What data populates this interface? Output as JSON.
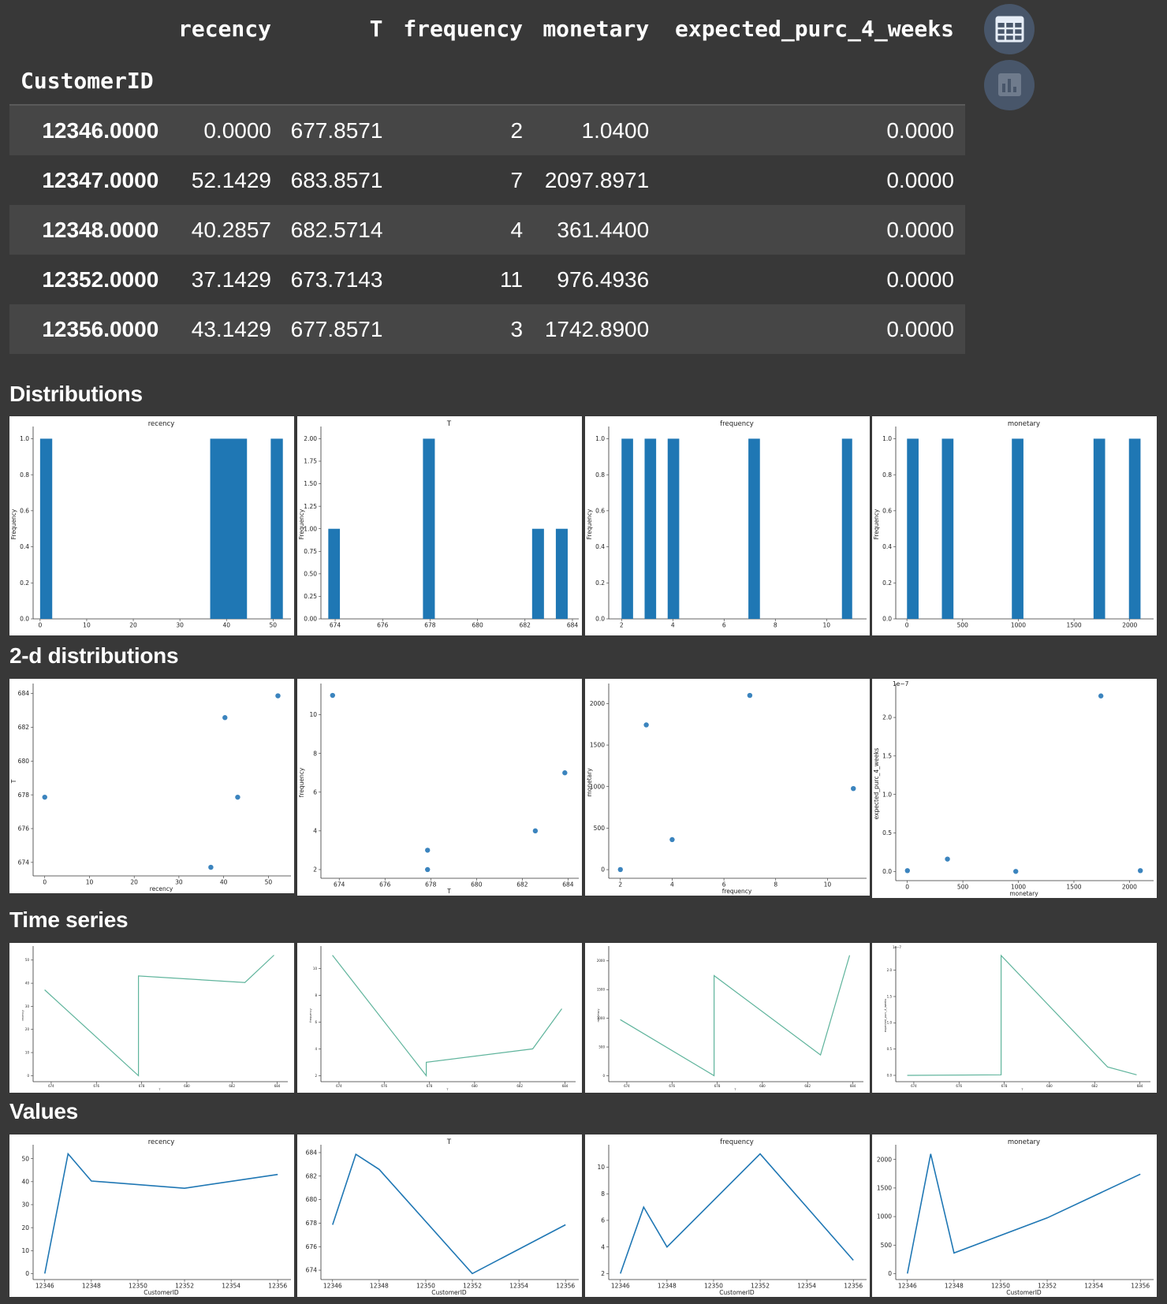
{
  "table": {
    "columns": [
      "recency",
      "T",
      "frequency",
      "monetary",
      "expected_purc_4_weeks"
    ],
    "index_name": "CustomerID",
    "rows": [
      {
        "id": "12346.0000",
        "cells": [
          "0.0000",
          "677.8571",
          "2",
          "1.0400",
          "0.0000"
        ]
      },
      {
        "id": "12347.0000",
        "cells": [
          "52.1429",
          "683.8571",
          "7",
          "2097.8971",
          "0.0000"
        ]
      },
      {
        "id": "12348.0000",
        "cells": [
          "40.2857",
          "682.5714",
          "4",
          "361.4400",
          "0.0000"
        ]
      },
      {
        "id": "12352.0000",
        "cells": [
          "37.1429",
          "673.7143",
          "11",
          "976.4936",
          "0.0000"
        ]
      },
      {
        "id": "12356.0000",
        "cells": [
          "43.1429",
          "677.8571",
          "3",
          "1742.8900",
          "0.0000"
        ]
      }
    ]
  },
  "side_buttons": {
    "table_icon": "table-icon",
    "chart_icon": "bar-chart-icon"
  },
  "sections": {
    "distributions": "Distributions",
    "bivariate": "2-d distributions",
    "timeseries": "Time series",
    "values": "Values"
  },
  "colors": {
    "bar": "#1f77b4",
    "line": "#1f77b4",
    "ts_line": "#5fb49c",
    "background": "#383838"
  },
  "chart_data": [
    {
      "type": "bar",
      "title": "recency",
      "ylabel": "Frequency",
      "xlabel": "",
      "bars": [
        [
          0,
          2.6,
          1
        ],
        [
          36.5,
          44.4,
          1
        ],
        [
          49.5,
          52.1,
          1
        ]
      ],
      "xlim": [
        -1.5,
        53.5
      ],
      "ylim": [
        0,
        1.05
      ],
      "xticks": [
        0,
        10,
        20,
        30,
        40,
        50
      ],
      "xtick_labels": [
        "0",
        "10",
        "20",
        "30",
        "40",
        "50"
      ],
      "yticks": [
        0,
        0.2,
        0.4,
        0.6,
        0.8,
        1.0
      ],
      "ytick_labels": [
        "0.0",
        "0.2",
        "0.4",
        "0.6",
        "0.8",
        "1.0"
      ]
    },
    {
      "type": "bar",
      "title": "T",
      "ylabel": "Frequency",
      "xlabel": "",
      "bars": [
        [
          673.71,
          674.2,
          1
        ],
        [
          677.7,
          678.2,
          2
        ],
        [
          682.3,
          682.8,
          1
        ],
        [
          683.3,
          683.8,
          1
        ]
      ],
      "xlim": [
        673.4,
        684.2
      ],
      "ylim": [
        0,
        2.1
      ],
      "xticks": [
        674,
        676,
        678,
        680,
        682,
        684
      ],
      "xtick_labels": [
        "674",
        "676",
        "678",
        "680",
        "682",
        "684"
      ],
      "yticks": [
        0,
        0.25,
        0.5,
        0.75,
        1.0,
        1.25,
        1.5,
        1.75,
        2.0
      ],
      "ytick_labels": [
        "0.00",
        "0.25",
        "0.50",
        "0.75",
        "1.00",
        "1.25",
        "1.50",
        "1.75",
        "2.00"
      ]
    },
    {
      "type": "bar",
      "title": "frequency",
      "ylabel": "Frequency",
      "xlabel": "",
      "bars": [
        [
          2,
          2.45,
          1
        ],
        [
          2.9,
          3.35,
          1
        ],
        [
          3.8,
          4.25,
          1
        ],
        [
          6.95,
          7.4,
          1
        ],
        [
          10.6,
          11,
          1
        ]
      ],
      "xlim": [
        1.5,
        11.5
      ],
      "ylim": [
        0,
        1.05
      ],
      "xticks": [
        2,
        4,
        6,
        8,
        10
      ],
      "xtick_labels": [
        "2",
        "4",
        "6",
        "8",
        "10"
      ],
      "yticks": [
        0,
        0.2,
        0.4,
        0.6,
        0.8,
        1.0
      ],
      "ytick_labels": [
        "0.0",
        "0.2",
        "0.4",
        "0.6",
        "0.8",
        "1.0"
      ]
    },
    {
      "type": "bar",
      "title": "monetary",
      "ylabel": "Frequency",
      "xlabel": "",
      "bars": [
        [
          1,
          105,
          1
        ],
        [
          314,
          418,
          1
        ],
        [
          942,
          1046,
          1
        ],
        [
          1675,
          1779,
          1
        ],
        [
          1993,
          2097,
          1
        ]
      ],
      "xlim": [
        -100,
        2200
      ],
      "ylim": [
        0,
        1.05
      ],
      "xticks": [
        0,
        500,
        1000,
        1500,
        2000
      ],
      "xtick_labels": [
        "0",
        "500",
        "1000",
        "1500",
        "2000"
      ],
      "yticks": [
        0,
        0.2,
        0.4,
        0.6,
        0.8,
        1.0
      ],
      "ytick_labels": [
        "0.0",
        "0.2",
        "0.4",
        "0.6",
        "0.8",
        "1.0"
      ]
    },
    {
      "type": "scatter",
      "title": "",
      "xlabel": "recency",
      "ylabel": "T",
      "points": [
        [
          0,
          677.86
        ],
        [
          52.14,
          683.86
        ],
        [
          40.29,
          682.57
        ],
        [
          37.14,
          673.71
        ],
        [
          43.14,
          677.86
        ]
      ],
      "xlim": [
        -2.6,
        54.7
      ],
      "ylim": [
        673.2,
        684.4
      ],
      "xticks": [
        0,
        10,
        20,
        30,
        40,
        50
      ],
      "xtick_labels": [
        "0",
        "10",
        "20",
        "30",
        "40",
        "50"
      ],
      "yticks": [
        674,
        676,
        678,
        680,
        682,
        684
      ],
      "ytick_labels": [
        "674",
        "676",
        "678",
        "680",
        "682",
        "684"
      ]
    },
    {
      "type": "scatter",
      "title": "",
      "xlabel": "T",
      "ylabel": "frequency",
      "points": [
        [
          677.86,
          2
        ],
        [
          683.86,
          7
        ],
        [
          682.57,
          4
        ],
        [
          673.71,
          11
        ],
        [
          677.86,
          3
        ]
      ],
      "xlim": [
        673.2,
        684.4
      ],
      "ylim": [
        1.55,
        11.45
      ],
      "xticks": [
        674,
        676,
        678,
        680,
        682,
        684
      ],
      "xtick_labels": [
        "674",
        "676",
        "678",
        "680",
        "682",
        "684"
      ],
      "yticks": [
        2,
        4,
        6,
        8,
        10
      ],
      "ytick_labels": [
        "2",
        "4",
        "6",
        "8",
        "10"
      ]
    },
    {
      "type": "scatter",
      "title": "",
      "xlabel": "frequency",
      "ylabel": "monetary",
      "points": [
        [
          2,
          1.04
        ],
        [
          7,
          2097.9
        ],
        [
          4,
          361.44
        ],
        [
          11,
          976.49
        ],
        [
          3,
          1742.89
        ]
      ],
      "xlim": [
        1.55,
        11.45
      ],
      "ylim": [
        -104,
        2203
      ],
      "xticks": [
        2,
        4,
        6,
        8,
        10
      ],
      "xtick_labels": [
        "2",
        "4",
        "6",
        "8",
        "10"
      ],
      "yticks": [
        0,
        500,
        1000,
        1500,
        2000
      ],
      "ytick_labels": [
        "0",
        "500",
        "1000",
        "1500",
        "2000"
      ]
    },
    {
      "type": "scatter",
      "title": "",
      "xlabel": "monetary",
      "ylabel": "expected_purc_4_weeks",
      "y_offset_label": "1e−7",
      "points": [
        [
          1.04,
          0.1
        ],
        [
          2097.9,
          0.1
        ],
        [
          361.44,
          1.6
        ],
        [
          976.49,
          0.0
        ],
        [
          1742.89,
          22.8
        ]
      ],
      "xlim": [
        -104,
        2203
      ],
      "ylim": [
        -1.2,
        24
      ],
      "xticks": [
        0,
        500,
        1000,
        1500,
        2000
      ],
      "xtick_labels": [
        "0",
        "500",
        "1000",
        "1500",
        "2000"
      ],
      "yticks": [
        0,
        5,
        10,
        15,
        20
      ],
      "ytick_labels": [
        "0.0",
        "0.5",
        "1.0",
        "1.5",
        "2.0"
      ]
    },
    {
      "type": "line",
      "title": "",
      "xlabel": "T",
      "ylabel": "recency",
      "style": "ts",
      "points": [
        [
          673.71,
          37.14
        ],
        [
          677.86,
          0
        ],
        [
          677.86,
          43.14
        ],
        [
          682.57,
          40.29
        ],
        [
          683.86,
          52.14
        ]
      ],
      "xlim": [
        673.2,
        684.4
      ],
      "ylim": [
        -2.6,
        54.7
      ],
      "xticks": [
        674,
        676,
        678,
        680,
        682,
        684
      ],
      "xtick_labels": [
        "674",
        "676",
        "678",
        "680",
        "682",
        "684"
      ],
      "yticks": [
        0,
        10,
        20,
        30,
        40,
        50
      ],
      "ytick_labels": [
        "0",
        "10",
        "20",
        "30",
        "40",
        "50"
      ]
    },
    {
      "type": "line",
      "title": "",
      "xlabel": "T",
      "ylabel": "frequency",
      "style": "ts",
      "points": [
        [
          673.71,
          11
        ],
        [
          677.86,
          2
        ],
        [
          677.86,
          3
        ],
        [
          682.57,
          4
        ],
        [
          683.86,
          7
        ]
      ],
      "xlim": [
        673.2,
        684.4
      ],
      "ylim": [
        1.55,
        11.45
      ],
      "xticks": [
        674,
        676,
        678,
        680,
        682,
        684
      ],
      "xtick_labels": [
        "674",
        "676",
        "678",
        "680",
        "682",
        "684"
      ],
      "yticks": [
        2,
        4,
        6,
        8,
        10
      ],
      "ytick_labels": [
        "2",
        "4",
        "6",
        "8",
        "10"
      ]
    },
    {
      "type": "line",
      "title": "",
      "xlabel": "T",
      "ylabel": "monetary",
      "style": "ts",
      "points": [
        [
          673.71,
          976.49
        ],
        [
          677.86,
          1.04
        ],
        [
          677.86,
          1742.89
        ],
        [
          682.57,
          361.44
        ],
        [
          683.86,
          2097.9
        ]
      ],
      "xlim": [
        673.2,
        684.4
      ],
      "ylim": [
        -104,
        2203
      ],
      "xticks": [
        674,
        676,
        678,
        680,
        682,
        684
      ],
      "xtick_labels": [
        "674",
        "676",
        "678",
        "680",
        "682",
        "684"
      ],
      "yticks": [
        0,
        500,
        1000,
        1500,
        2000
      ],
      "ytick_labels": [
        "0",
        "500",
        "1000",
        "1500",
        "2000"
      ]
    },
    {
      "type": "line",
      "title": "",
      "xlabel": "T",
      "ylabel": "expected_purc_4_weeks",
      "style": "ts",
      "y_offset_label": "1e−7",
      "points": [
        [
          673.71,
          0
        ],
        [
          677.86,
          0.1
        ],
        [
          677.86,
          22.8
        ],
        [
          682.57,
          1.6
        ],
        [
          683.86,
          0.1
        ]
      ],
      "xlim": [
        673.2,
        684.4
      ],
      "ylim": [
        -1.2,
        24
      ],
      "xticks": [
        674,
        676,
        678,
        680,
        682,
        684
      ],
      "xtick_labels": [
        "674",
        "676",
        "678",
        "680",
        "682",
        "684"
      ],
      "yticks": [
        0,
        5,
        10,
        15,
        20
      ],
      "ytick_labels": [
        "0.0",
        "0.5",
        "1.0",
        "1.5",
        "2.0"
      ]
    },
    {
      "type": "line",
      "title": "recency",
      "xlabel": "CustomerID",
      "ylabel": "",
      "points": [
        [
          12346,
          0
        ],
        [
          12347,
          52.14
        ],
        [
          12348,
          40.29
        ],
        [
          12352,
          37.14
        ],
        [
          12356,
          43.14
        ]
      ],
      "xlim": [
        12345.5,
        12356.5
      ],
      "ylim": [
        -2.6,
        54.7
      ],
      "xticks": [
        12346,
        12348,
        12350,
        12352,
        12354,
        12356
      ],
      "xtick_labels": [
        "12346",
        "12348",
        "12350",
        "12352",
        "12354",
        "12356"
      ],
      "yticks": [
        0,
        10,
        20,
        30,
        40,
        50
      ],
      "ytick_labels": [
        "0",
        "10",
        "20",
        "30",
        "40",
        "50"
      ]
    },
    {
      "type": "line",
      "title": "T",
      "xlabel": "CustomerID",
      "ylabel": "",
      "points": [
        [
          12346,
          677.86
        ],
        [
          12347,
          683.86
        ],
        [
          12348,
          682.57
        ],
        [
          12352,
          673.71
        ],
        [
          12356,
          677.86
        ]
      ],
      "xlim": [
        12345.5,
        12356.5
      ],
      "ylim": [
        673.2,
        684.4
      ],
      "xticks": [
        12346,
        12348,
        12350,
        12352,
        12354,
        12356
      ],
      "xtick_labels": [
        "12346",
        "12348",
        "12350",
        "12352",
        "12354",
        "12356"
      ],
      "yticks": [
        674,
        676,
        678,
        680,
        682,
        684
      ],
      "ytick_labels": [
        "674",
        "676",
        "678",
        "680",
        "682",
        "684"
      ]
    },
    {
      "type": "line",
      "title": "frequency",
      "xlabel": "CustomerID",
      "ylabel": "",
      "points": [
        [
          12346,
          2
        ],
        [
          12347,
          7
        ],
        [
          12348,
          4
        ],
        [
          12352,
          11
        ],
        [
          12356,
          3
        ]
      ],
      "xlim": [
        12345.5,
        12356.5
      ],
      "ylim": [
        1.55,
        11.45
      ],
      "xticks": [
        12346,
        12348,
        12350,
        12352,
        12354,
        12356
      ],
      "xtick_labels": [
        "12346",
        "12348",
        "12350",
        "12352",
        "12354",
        "12356"
      ],
      "yticks": [
        2,
        4,
        6,
        8,
        10
      ],
      "ytick_labels": [
        "2",
        "4",
        "6",
        "8",
        "10"
      ]
    },
    {
      "type": "line",
      "title": "monetary",
      "xlabel": "CustomerID",
      "ylabel": "",
      "points": [
        [
          12346,
          1.04
        ],
        [
          12347,
          2097.9
        ],
        [
          12348,
          361.44
        ],
        [
          12352,
          976.49
        ],
        [
          12356,
          1742.89
        ]
      ],
      "xlim": [
        12345.5,
        12356.5
      ],
      "ylim": [
        -104,
        2203
      ],
      "xticks": [
        12346,
        12348,
        12350,
        12352,
        12354,
        12356
      ],
      "xtick_labels": [
        "12346",
        "12348",
        "12350",
        "12352",
        "12354",
        "12356"
      ],
      "yticks": [
        0,
        500,
        1000,
        1500,
        2000
      ],
      "ytick_labels": [
        "0",
        "500",
        "1000",
        "1500",
        "2000"
      ]
    }
  ]
}
